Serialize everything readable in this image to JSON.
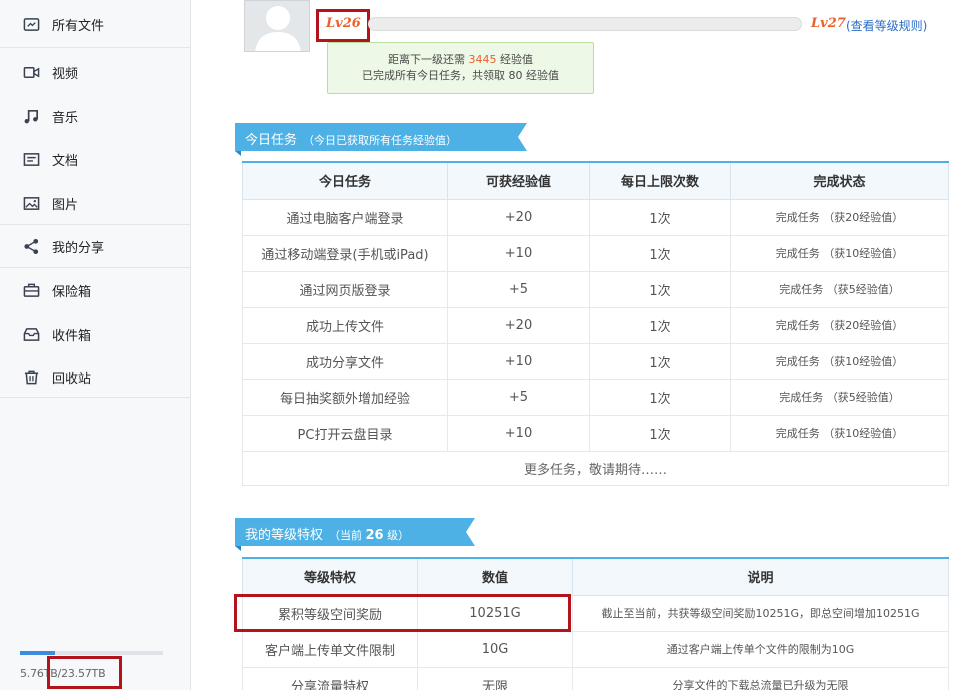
{
  "sidebar": {
    "items": [
      {
        "label": "所有文件",
        "icon": "all-files-icon"
      },
      {
        "label": "视频",
        "icon": "video-icon"
      },
      {
        "label": "音乐",
        "icon": "music-icon"
      },
      {
        "label": "文档",
        "icon": "document-icon"
      },
      {
        "label": "图片",
        "icon": "image-icon"
      },
      {
        "label": "我的分享",
        "icon": "share-icon"
      },
      {
        "label": "保险箱",
        "icon": "safe-icon"
      },
      {
        "label": "收件箱",
        "icon": "inbox-icon"
      },
      {
        "label": "回收站",
        "icon": "trash-icon"
      }
    ],
    "quota": {
      "text": "5.76TB/23.57TB",
      "used_fraction": 0.244
    }
  },
  "level": {
    "current": "Lv26",
    "next": "Lv27",
    "rules_link": "(查看等级规则)",
    "tip_line1_prefix": "距离下一级还需",
    "tip_points": "3445",
    "tip_line1_suffix": "经验值",
    "tip_line2": "已完成所有今日任务，共领取 80 经验值"
  },
  "tasks": {
    "title": "今日任务",
    "subtitle": "（今日已获取所有任务经验值）",
    "headers": [
      "今日任务",
      "可获经验值",
      "每日上限次数",
      "完成状态"
    ],
    "rows": [
      [
        "通过电脑客户端登录",
        "+20",
        "1次",
        "完成任务 （获20经验值）"
      ],
      [
        "通过移动端登录(手机或iPad)",
        "+10",
        "1次",
        "完成任务 （获10经验值）"
      ],
      [
        "通过网页版登录",
        "+5",
        "1次",
        "完成任务 （获5经验值）"
      ],
      [
        "成功上传文件",
        "+20",
        "1次",
        "完成任务 （获20经验值）"
      ],
      [
        "成功分享文件",
        "+10",
        "1次",
        "完成任务 （获10经验值）"
      ],
      [
        "每日抽奖额外增加经验",
        "+5",
        "1次",
        "完成任务 （获5经验值）"
      ],
      [
        "PC打开云盘目录",
        "+10",
        "1次",
        "完成任务 （获10经验值）"
      ]
    ],
    "more": "更多任务，敬请期待……"
  },
  "privileges": {
    "title": "我的等级特权",
    "subtitle_prefix": "（当前",
    "subtitle_level": "26",
    "subtitle_suffix": "级）",
    "headers": [
      "等级特权",
      "数值",
      "说明"
    ],
    "rows": [
      [
        "累积等级空间奖励",
        "10251G",
        "截止至当前，共获等级空间奖励10251G，即总空间增加10251G"
      ],
      [
        "客户端上传单文件限制",
        "10G",
        "通过客户端上传单个文件的限制为10G"
      ],
      [
        "分享流量特权",
        "无限",
        "分享文件的下载总流量已升级为无限"
      ]
    ]
  },
  "colors": {
    "accent": "#4db1e6",
    "level": "#e8612c",
    "annotation": "#b3141b"
  }
}
